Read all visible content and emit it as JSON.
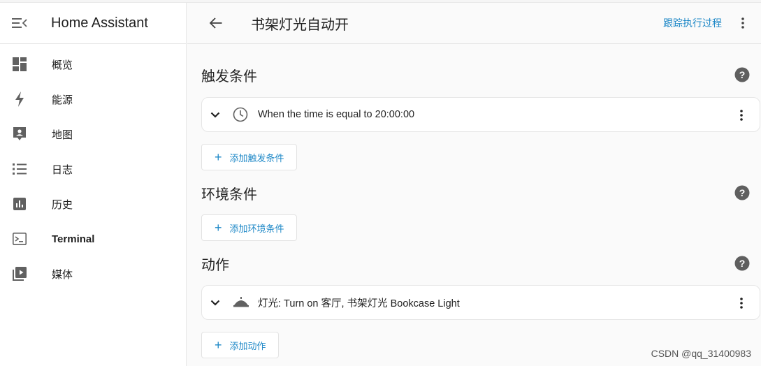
{
  "sidebar": {
    "title": "Home Assistant",
    "items": [
      {
        "label": "概览",
        "icon": "dashboard-icon"
      },
      {
        "label": "能源",
        "icon": "lightning-icon"
      },
      {
        "label": "地图",
        "icon": "map-account-icon"
      },
      {
        "label": "日志",
        "icon": "logbook-list-icon"
      },
      {
        "label": "历史",
        "icon": "history-chart-icon"
      },
      {
        "label": "Terminal",
        "icon": "terminal-icon"
      },
      {
        "label": "媒体",
        "icon": "media-play-icon"
      }
    ]
  },
  "header": {
    "title": "书架灯光自动开",
    "trace_label": "跟踪执行过程"
  },
  "triggers": {
    "title": "触发条件",
    "items": [
      {
        "text": "When the time is equal to 20:00:00",
        "icon": "clock-icon"
      }
    ],
    "add_label": "添加触发条件"
  },
  "conditions": {
    "title": "环境条件",
    "add_label": "添加环境条件"
  },
  "actions": {
    "title": "动作",
    "items": [
      {
        "text": "灯光: Turn on 客厅, 书架灯光 Bookcase Light",
        "icon": "ceiling-light-icon"
      }
    ],
    "add_label": "添加动作"
  },
  "watermark": "CSDN @qq_31400983",
  "colors": {
    "accent": "#1e88c7",
    "icon": "#616161",
    "help": "#5f5f5f"
  }
}
